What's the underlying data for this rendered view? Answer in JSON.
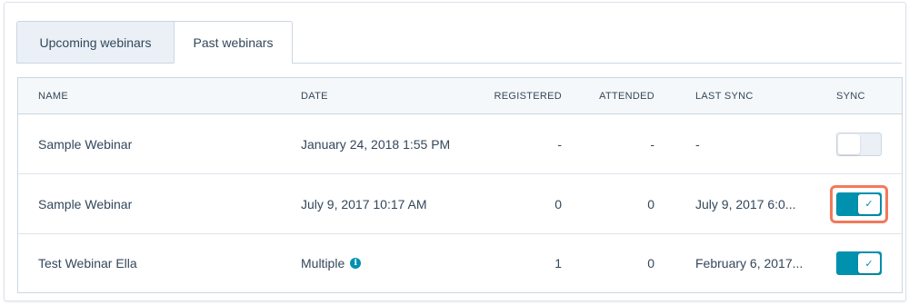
{
  "tabs": [
    {
      "label": "Upcoming webinars",
      "active": false
    },
    {
      "label": "Past webinars",
      "active": true
    }
  ],
  "table": {
    "headers": {
      "name": "NAME",
      "date": "DATE",
      "registered": "REGISTERED",
      "attended": "ATTENDED",
      "last_sync": "LAST SYNC",
      "sync": "SYNC"
    },
    "rows": [
      {
        "name": "Sample Webinar",
        "date": "January 24, 2018 1:55 PM",
        "registered": "-",
        "attended": "-",
        "last_sync": "-",
        "sync_on": false
      },
      {
        "name": "Sample Webinar",
        "date": "July 9, 2017 10:17 AM",
        "registered": "0",
        "attended": "0",
        "last_sync": "July 9, 2017 6:0...",
        "sync_on": true
      },
      {
        "name": "Test Webinar Ella",
        "date": "Multiple",
        "registered": "1",
        "attended": "0",
        "last_sync": "February 6, 2017...",
        "sync_on": true
      }
    ]
  },
  "icons": {
    "info": "info-icon",
    "check": "✓",
    "info_glyph": "i"
  },
  "colors": {
    "accent": "#0091ae",
    "highlight": "#f2795b",
    "header_bg": "#f5f8fa",
    "text": "#33475b"
  }
}
